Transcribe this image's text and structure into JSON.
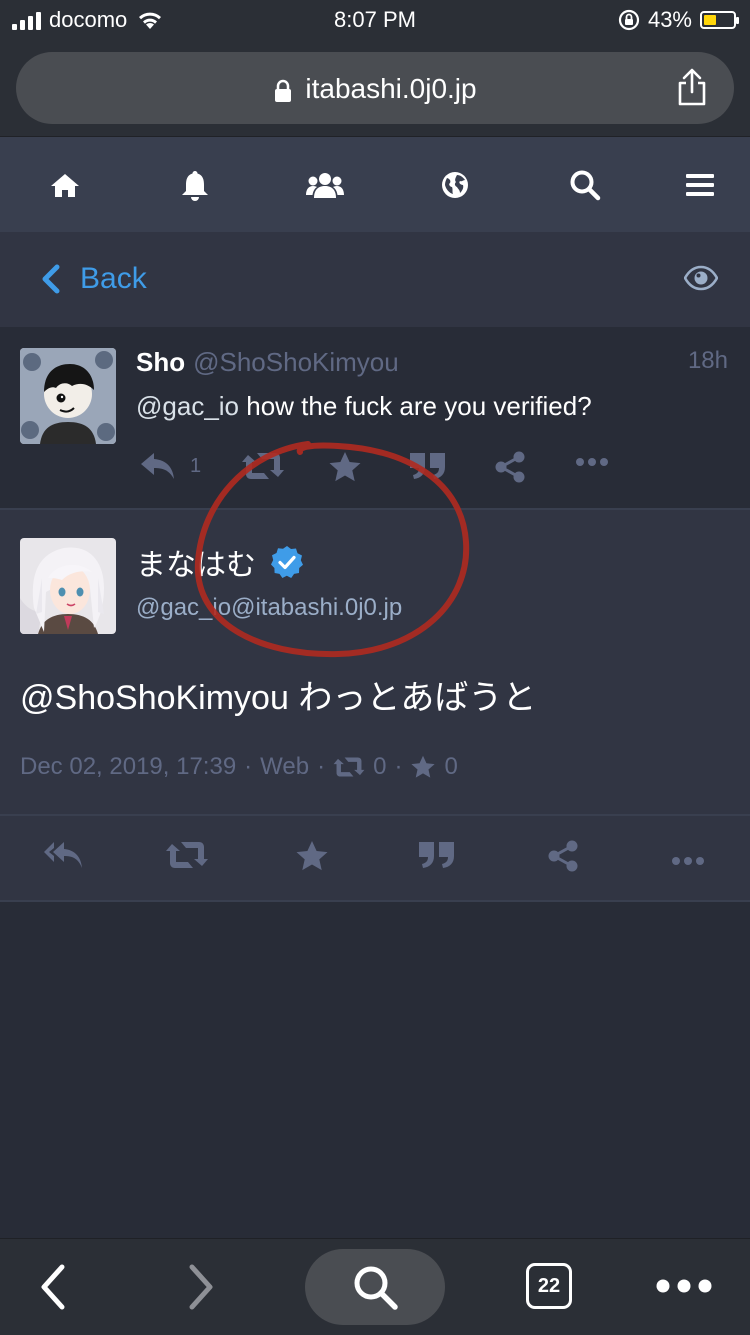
{
  "status_bar": {
    "carrier": "docomo",
    "time": "8:07 PM",
    "battery_percent": "43%",
    "battery_level": 0.43
  },
  "browser": {
    "url": "itabashi.0j0.jp",
    "tabs_count": "22"
  },
  "nav": {
    "icons": [
      "home-icon",
      "bell-icon",
      "users-icon",
      "globe-icon",
      "search-icon",
      "menu-icon"
    ]
  },
  "back_bar": {
    "label": "Back"
  },
  "reply_status": {
    "display_name": "Sho",
    "acct": "@ShoShoKimyou",
    "time": "18h",
    "mention": "@gac_io",
    "text": " how the fuck are you verified?",
    "reply_count": "1"
  },
  "main_status": {
    "display_name": "まなはむ",
    "acct": "@gac_io@itabashi.0j0.jp",
    "mention": "@ShoShoKimyou",
    "text": " わっとあばうと",
    "date": "Dec 02, 2019, 17:39",
    "app": "Web",
    "reblogs": "0",
    "favourites": "0",
    "sep": "·"
  },
  "colors": {
    "accent": "#3f9ce8",
    "muted": "#606984",
    "annotation": "#b02a20"
  }
}
